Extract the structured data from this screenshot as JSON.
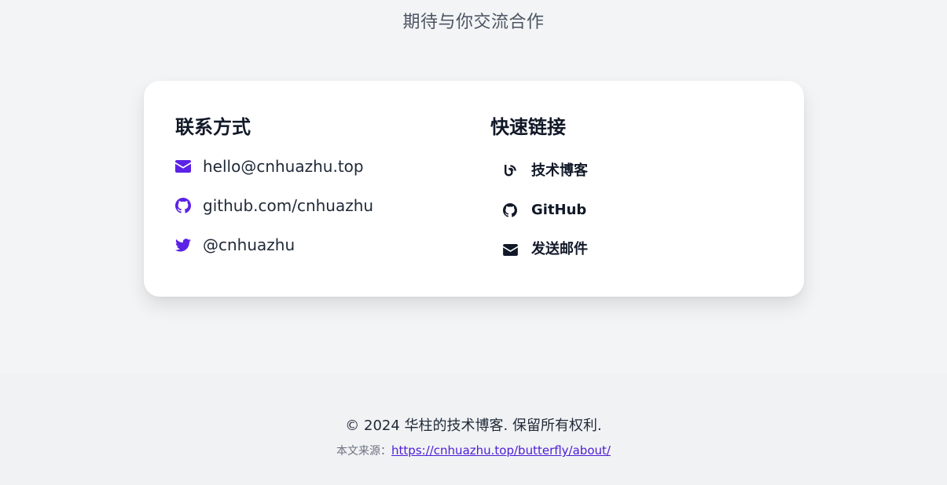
{
  "header": {
    "subtitle": "期待与你交流合作"
  },
  "contact": {
    "title": "联系方式",
    "items": [
      {
        "icon": "envelope-icon",
        "text": "hello@cnhuazhu.top"
      },
      {
        "icon": "github-icon",
        "text": "github.com/cnhuazhu"
      },
      {
        "icon": "twitter-icon",
        "text": "@cnhuazhu"
      }
    ]
  },
  "quick_links": {
    "title": "快速链接",
    "items": [
      {
        "icon": "blog-icon",
        "text": "技术博客"
      },
      {
        "icon": "github-icon",
        "text": "GitHub"
      },
      {
        "icon": "envelope-icon",
        "text": "发送邮件"
      }
    ]
  },
  "footer": {
    "copyright": "© 2024 华柱的技术博客. 保留所有权利.",
    "source_label": "本文来源：",
    "source_url": "https://cnhuazhu.top/butterfly/about/"
  },
  "colors": {
    "accent": "#5b21e6",
    "background": "#f3f4f6",
    "card": "#ffffff",
    "text": "#111827"
  }
}
